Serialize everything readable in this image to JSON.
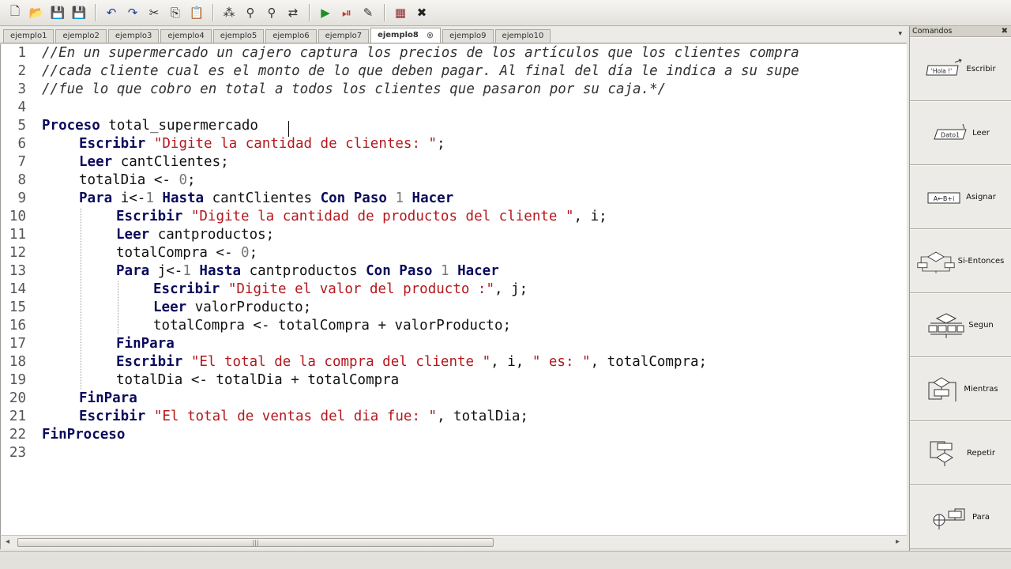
{
  "toolbar": {
    "buttons": [
      {
        "name": "new-file",
        "glyph": "🗋"
      },
      {
        "name": "open-file",
        "glyph": "📂"
      },
      {
        "name": "save-file",
        "glyph": "💾"
      },
      {
        "name": "save-as",
        "glyph": "💾"
      },
      {
        "name": "undo",
        "glyph": "↶"
      },
      {
        "name": "redo",
        "glyph": "↷"
      },
      {
        "name": "cut",
        "glyph": "✂"
      },
      {
        "name": "copy",
        "glyph": "⎘"
      },
      {
        "name": "paste",
        "glyph": "📋"
      },
      {
        "name": "indent",
        "glyph": "⁂"
      },
      {
        "name": "find",
        "glyph": "⚲"
      },
      {
        "name": "find-next",
        "glyph": "⚲"
      },
      {
        "name": "replace",
        "glyph": "⇄"
      },
      {
        "name": "run",
        "glyph": "▶"
      },
      {
        "name": "run-step",
        "glyph": "⏯"
      },
      {
        "name": "debug",
        "glyph": "✎"
      },
      {
        "name": "flowchart",
        "glyph": "▦"
      },
      {
        "name": "close",
        "glyph": "✖"
      }
    ]
  },
  "tabs": [
    {
      "label": "ejemplo1"
    },
    {
      "label": "ejemplo2"
    },
    {
      "label": "ejemplo3"
    },
    {
      "label": "ejemplo4"
    },
    {
      "label": "ejemplo5"
    },
    {
      "label": "ejemplo6"
    },
    {
      "label": "ejemplo7"
    },
    {
      "label": "ejemplo8",
      "active": true
    },
    {
      "label": "ejemplo9"
    },
    {
      "label": "ejemplo10"
    }
  ],
  "tab_close_glyph": "⊗",
  "tab_menu_glyph": "▾",
  "editor": {
    "lines": [
      {
        "n": "1",
        "indent": 0,
        "tokens": [
          [
            "cm",
            "//En un supermercado un cajero captura los precios de los artículos que los clientes compra"
          ]
        ]
      },
      {
        "n": "2",
        "indent": 0,
        "tokens": [
          [
            "cm",
            "//cada cliente cual es el monto de lo que deben pagar. Al final del día le indica a su supe"
          ]
        ]
      },
      {
        "n": "3",
        "indent": 0,
        "tokens": [
          [
            "cm",
            "//fue lo que cobro en total a todos los clientes que pasaron por su caja.*/"
          ]
        ]
      },
      {
        "n": "4",
        "indent": 0,
        "tokens": []
      },
      {
        "n": "5",
        "indent": 0,
        "tokens": [
          [
            "kw",
            "Proceso"
          ],
          [
            "tx",
            " total_supermercado"
          ]
        ]
      },
      {
        "n": "6",
        "indent": 1,
        "tokens": [
          [
            "kw",
            "Escribir"
          ],
          [
            "tx",
            " "
          ],
          [
            "st",
            "\"Digite la cantidad de clientes: \""
          ],
          [
            "tx",
            ";"
          ]
        ]
      },
      {
        "n": "7",
        "indent": 1,
        "tokens": [
          [
            "kw",
            "Leer"
          ],
          [
            "tx",
            " cantClientes;"
          ]
        ]
      },
      {
        "n": "8",
        "indent": 1,
        "tokens": [
          [
            "tx",
            "totalDia <- "
          ],
          [
            "nm",
            "0"
          ],
          [
            "tx",
            ";"
          ]
        ]
      },
      {
        "n": "9",
        "indent": 1,
        "tokens": [
          [
            "kw",
            "Para"
          ],
          [
            "tx",
            " i<-"
          ],
          [
            "nm",
            "1"
          ],
          [
            "tx",
            " "
          ],
          [
            "kw",
            "Hasta"
          ],
          [
            "tx",
            " cantClientes "
          ],
          [
            "kw",
            "Con Paso"
          ],
          [
            "tx",
            " "
          ],
          [
            "nm",
            "1"
          ],
          [
            "tx",
            " "
          ],
          [
            "kw",
            "Hacer"
          ]
        ]
      },
      {
        "n": "10",
        "indent": 2,
        "tokens": [
          [
            "kw",
            "Escribir"
          ],
          [
            "tx",
            " "
          ],
          [
            "st",
            "\"Digite la cantidad de productos del cliente \""
          ],
          [
            "tx",
            ", i;"
          ]
        ]
      },
      {
        "n": "11",
        "indent": 2,
        "tokens": [
          [
            "kw",
            "Leer"
          ],
          [
            "tx",
            " cantproductos;"
          ]
        ]
      },
      {
        "n": "12",
        "indent": 2,
        "tokens": [
          [
            "tx",
            "totalCompra <- "
          ],
          [
            "nm",
            "0"
          ],
          [
            "tx",
            ";"
          ]
        ]
      },
      {
        "n": "13",
        "indent": 2,
        "tokens": [
          [
            "kw",
            "Para"
          ],
          [
            "tx",
            " j<-"
          ],
          [
            "nm",
            "1"
          ],
          [
            "tx",
            " "
          ],
          [
            "kw",
            "Hasta"
          ],
          [
            "tx",
            " cantproductos "
          ],
          [
            "kw",
            "Con Paso"
          ],
          [
            "tx",
            " "
          ],
          [
            "nm",
            "1"
          ],
          [
            "tx",
            " "
          ],
          [
            "kw",
            "Hacer"
          ]
        ]
      },
      {
        "n": "14",
        "indent": 3,
        "tokens": [
          [
            "kw",
            "Escribir"
          ],
          [
            "tx",
            " "
          ],
          [
            "st",
            "\"Digite el valor del producto :\""
          ],
          [
            "tx",
            ", j;"
          ]
        ]
      },
      {
        "n": "15",
        "indent": 3,
        "tokens": [
          [
            "kw",
            "Leer"
          ],
          [
            "tx",
            " valorProducto;"
          ]
        ]
      },
      {
        "n": "16",
        "indent": 3,
        "tokens": [
          [
            "tx",
            "totalCompra <- totalCompra + valorProducto;"
          ]
        ]
      },
      {
        "n": "17",
        "indent": 2,
        "tokens": [
          [
            "kw",
            "FinPara"
          ]
        ]
      },
      {
        "n": "18",
        "indent": 2,
        "tokens": [
          [
            "kw",
            "Escribir"
          ],
          [
            "tx",
            " "
          ],
          [
            "st",
            "\"El total de la compra del cliente \""
          ],
          [
            "tx",
            ", i, "
          ],
          [
            "st",
            "\" es: \""
          ],
          [
            "tx",
            ", totalCompra;"
          ]
        ]
      },
      {
        "n": "19",
        "indent": 2,
        "tokens": [
          [
            "tx",
            "totalDia <- totalDia + totalCompra"
          ]
        ]
      },
      {
        "n": "20",
        "indent": 1,
        "tokens": [
          [
            "kw",
            "FinPara"
          ]
        ]
      },
      {
        "n": "21",
        "indent": 1,
        "tokens": [
          [
            "kw",
            "Escribir"
          ],
          [
            "tx",
            " "
          ],
          [
            "st",
            "\"El total de ventas del dia fue: \""
          ],
          [
            "tx",
            ", totalDia;"
          ]
        ]
      },
      {
        "n": "22",
        "indent": 0,
        "tokens": [
          [
            "kw",
            "FinProceso"
          ]
        ]
      },
      {
        "n": "23",
        "indent": 0,
        "tokens": []
      }
    ]
  },
  "scrollbar": {
    "left_arrow": "◂",
    "right_arrow": "▸",
    "thumb_grip": "|||"
  },
  "commands": {
    "title": "Comandos",
    "close_glyph": "✖",
    "items": [
      {
        "label": "Escribir",
        "icon": "escribir-icon",
        "icon_text": "'Hola !'"
      },
      {
        "label": "Leer",
        "icon": "leer-icon",
        "icon_text": "Dato1"
      },
      {
        "label": "Asignar",
        "icon": "asignar-icon",
        "icon_text": "A←B+i"
      },
      {
        "label": "Si-Entonces",
        "icon": "si-entonces-icon",
        "icon_text": ""
      },
      {
        "label": "Segun",
        "icon": "segun-icon",
        "icon_text": ""
      },
      {
        "label": "Mientras",
        "icon": "mientras-icon",
        "icon_text": ""
      },
      {
        "label": "Repetir",
        "icon": "repetir-icon",
        "icon_text": ""
      },
      {
        "label": "Para",
        "icon": "para-icon",
        "icon_text": ""
      }
    ]
  }
}
